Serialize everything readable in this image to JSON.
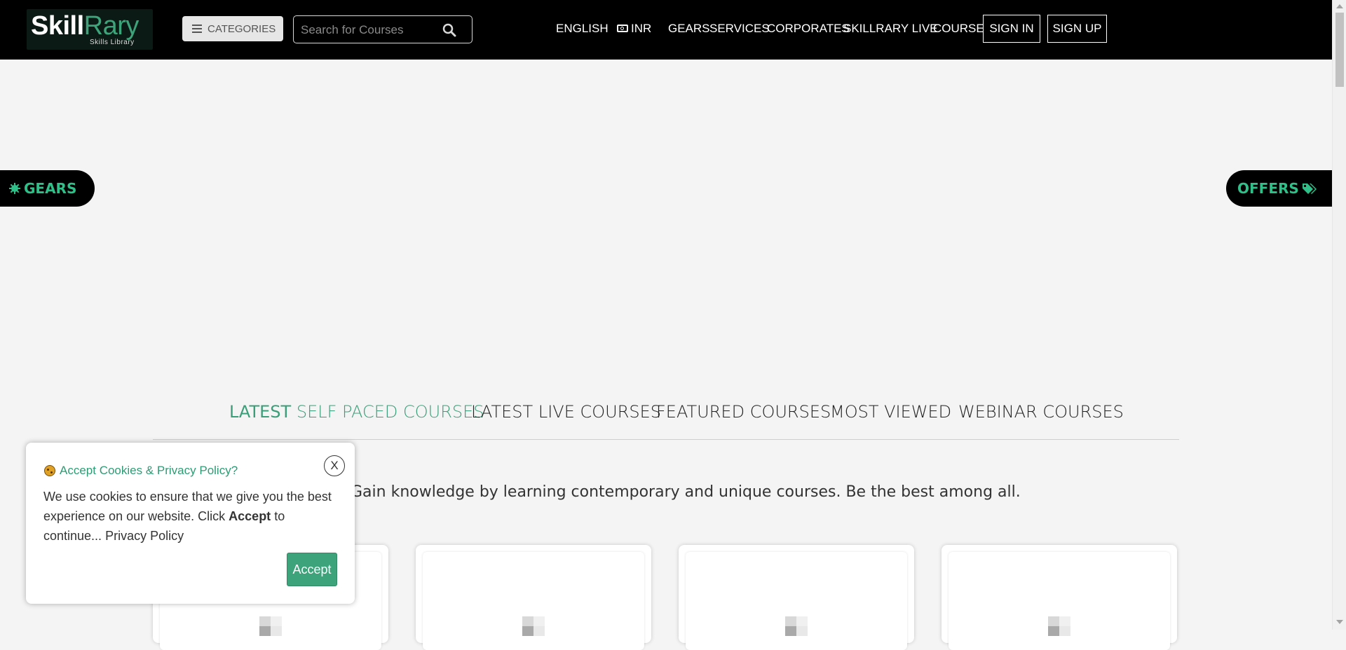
{
  "header": {
    "logo_main_a": "Skill",
    "logo_main_b": "Rary",
    "logo_sub": "Skills Library",
    "categories_label": "CATEGORIES",
    "search_placeholder": "Search for Courses",
    "nav": {
      "english": "ENGLISH",
      "currency": "INR",
      "gears": "GEARS",
      "services": "SERVICES",
      "corporates": "CORPORATES",
      "skillrary_live": "SKILLRARY LIVE",
      "course": "COURSE"
    },
    "sign_in": "SIGN IN",
    "sign_up": "SIGN UP"
  },
  "side_tabs": {
    "gears": "GEARS",
    "offers": "OFFERS"
  },
  "tabs": {
    "latest_prefix": "LATEST",
    "latest_rest": "SELF PACED COURSES",
    "live": "LATEST LIVE COURSES",
    "featured": "FEATURED COURSES",
    "most_viewed": "MOST VIEWED",
    "webinar": "WEBINAR COURSES"
  },
  "tagline": "Gain knowledge by learning contemporary and unique courses. Be the best among all.",
  "cookie": {
    "close": "X",
    "title": "Accept Cookies & Privacy Policy?",
    "text_a": "We use cookies to ensure that we give you the best experience on our website. Click",
    "text_bold": "Accept",
    "text_b": "to continue...",
    "privacy_link": "Privacy Policy",
    "accept": "Accept"
  },
  "colors": {
    "brand_green": "#3ca37a",
    "nav_bg": "#000000",
    "page_bg": "#f4f4f4",
    "side_tab_text": "#2fc08a"
  }
}
